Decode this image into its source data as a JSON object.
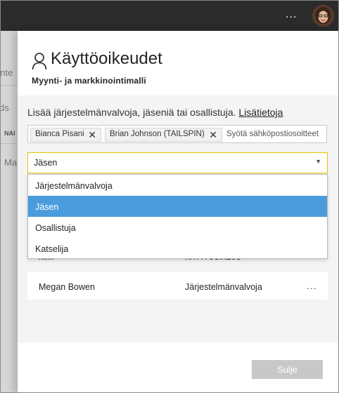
{
  "topbar": {
    "more_label": "...",
    "avatar_icon": "user-avatar"
  },
  "background": {
    "fragments": [
      "onte",
      "ds",
      "NAI",
      "Ma"
    ]
  },
  "panel": {
    "title": "Käyttöoikeudet",
    "subtitle": "Myynti- ja markkinointimalli",
    "intro_text": "Lisää järjestelmänvalvoja, jäseniä tai osallistuja.",
    "intro_link": "Lisätietoja",
    "chips": [
      {
        "label": "Bianca Pisani"
      },
      {
        "label": "Brian Johnson (TAILSPIN)"
      }
    ],
    "email_placeholder": "Syötä sähköpostiosoitteet",
    "role_select": {
      "value": "Jäsen"
    },
    "role_options": [
      "Järjestelmänvalvoja",
      "Jäsen",
      "Osallistuja",
      "Katselija"
    ],
    "selected_option": "Jäsen",
    "columns": {
      "name": "NIMI",
      "permission": "KÄYTTÖOIKEUS"
    },
    "users": [
      {
        "name": "Megan Bowen",
        "permission": "Järjestelmänvalvoja",
        "more": "..."
      }
    ],
    "close_label": "Sulje"
  },
  "colors": {
    "accent_select_border": "#e1c300",
    "selected_option": "#4a9cdc",
    "topbar": "#2b2b2b"
  }
}
